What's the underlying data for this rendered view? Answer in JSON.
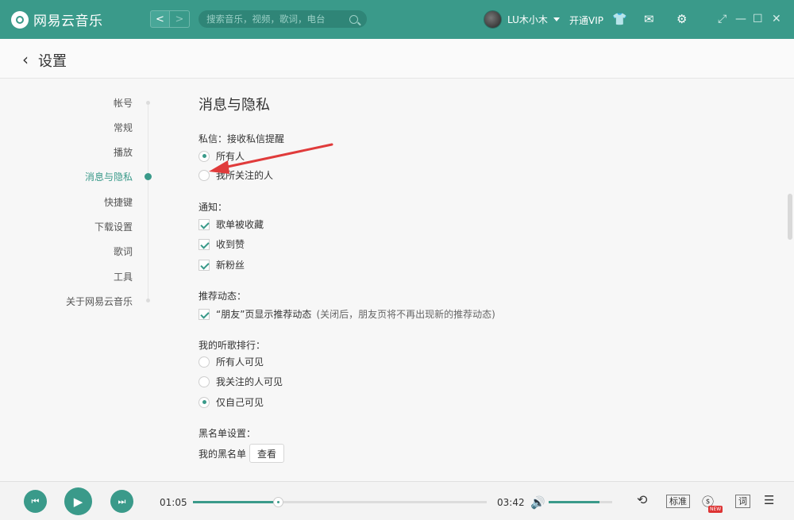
{
  "app": {
    "brand_name": "网易云音乐",
    "search_placeholder": "搜索音乐，视频，歌词，电台",
    "nav_back": "<",
    "nav_forward": ">",
    "username": "LU木小木",
    "vip_label": "开通VIP",
    "icons": {
      "skin": "👕",
      "mail": "✉",
      "settings": "⚙",
      "mini_mode": "⤢",
      "minimize": "—",
      "maximize": "☐",
      "close": "✕"
    }
  },
  "header": {
    "back": "‹",
    "title": "设置"
  },
  "sidenav": {
    "items": [
      {
        "label": "帐号",
        "active": false
      },
      {
        "label": "常规",
        "active": false
      },
      {
        "label": "播放",
        "active": false
      },
      {
        "label": "消息与隐私",
        "active": true
      },
      {
        "label": "快捷键",
        "active": false
      },
      {
        "label": "下载设置",
        "active": false
      },
      {
        "label": "歌词",
        "active": false
      },
      {
        "label": "工具",
        "active": false
      },
      {
        "label": "关于网易云音乐",
        "active": false
      }
    ]
  },
  "content": {
    "section_title": "消息与隐私",
    "private_msg": {
      "label": "私信：接收私信提醒",
      "options": [
        {
          "label": "所有人",
          "checked": true
        },
        {
          "label": "我所关注的人",
          "checked": false
        }
      ]
    },
    "notify": {
      "label": "通知：",
      "options": [
        {
          "label": "歌单被收藏",
          "checked": true
        },
        {
          "label": "收到赞",
          "checked": true
        },
        {
          "label": "新粉丝",
          "checked": true
        }
      ]
    },
    "recommend": {
      "label": "推荐动态：",
      "option": {
        "label": "“朋友”页显示推荐动态",
        "checked": true
      },
      "note": "(关闭后，朋友页将不再出现新的推荐动态)"
    },
    "ranking": {
      "label": "我的听歌排行：",
      "options": [
        {
          "label": "所有人可见",
          "checked": false
        },
        {
          "label": "我关注的人可见",
          "checked": false
        },
        {
          "label": "仅自己可见",
          "checked": true
        }
      ]
    },
    "blacklist": {
      "label": "黑名单设置：",
      "row_label": "我的黑名单",
      "button": "查看"
    }
  },
  "player": {
    "current_time": "01:05",
    "total_time": "03:42",
    "progress_fraction": 0.29,
    "volume_fraction": 0.8,
    "prev_icon": "⏮",
    "play_icon": "▶",
    "next_icon": "⏭",
    "volume_icon": "🔊",
    "loop_icon": "⟲",
    "quality_label": "标准",
    "effect_icon": "ⓢ",
    "new_badge": "NEW",
    "lyrics_label": "词",
    "playlist_icon": "☰"
  },
  "colors": {
    "accent": "#3a9a8a",
    "arrow": "#e03b3b"
  }
}
